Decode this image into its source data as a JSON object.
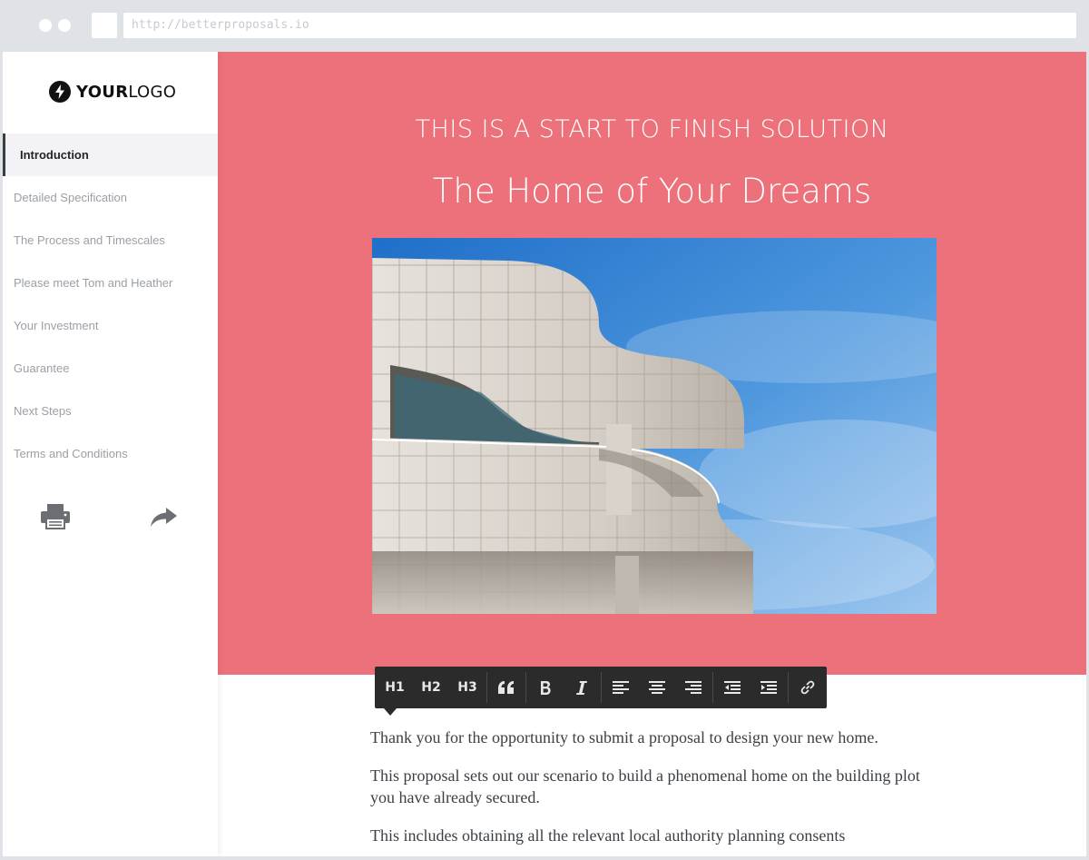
{
  "browser": {
    "url": "http://betterproposals.io"
  },
  "sidebar": {
    "logo": {
      "part1": "YOUR",
      "part2": "LOGO"
    },
    "items": [
      {
        "label": "Introduction",
        "active": true
      },
      {
        "label": "Detailed Specification"
      },
      {
        "label": "The Process and Timescales"
      },
      {
        "label": "Please meet Tom and Heather"
      },
      {
        "label": "Your Investment"
      },
      {
        "label": "Guarantee"
      },
      {
        "label": "Next Steps"
      },
      {
        "label": "Terms and Conditions"
      }
    ],
    "actions": {
      "print_icon": "printer-icon",
      "share_icon": "share-arrow-icon"
    }
  },
  "hero": {
    "kicker": "THIS IS A START TO FINISH SOLUTION",
    "title": "The Home of Your Dreams",
    "background_color": "#ed717a"
  },
  "toolbar": {
    "h1": "H1",
    "h2": "H2",
    "h3": "H3",
    "icons": [
      "quote-icon",
      "bold-icon",
      "italic-icon",
      "align-left-icon",
      "align-center-icon",
      "align-right-icon",
      "outdent-icon",
      "indent-icon",
      "link-icon"
    ]
  },
  "content": {
    "paragraphs": [
      "Thank you for the opportunity to submit a proposal to design your new home.",
      "This proposal sets out our scenario to build a phenomenal home on the building plot you have already secured.",
      "This includes obtaining all the relevant local authority planning consents"
    ]
  }
}
